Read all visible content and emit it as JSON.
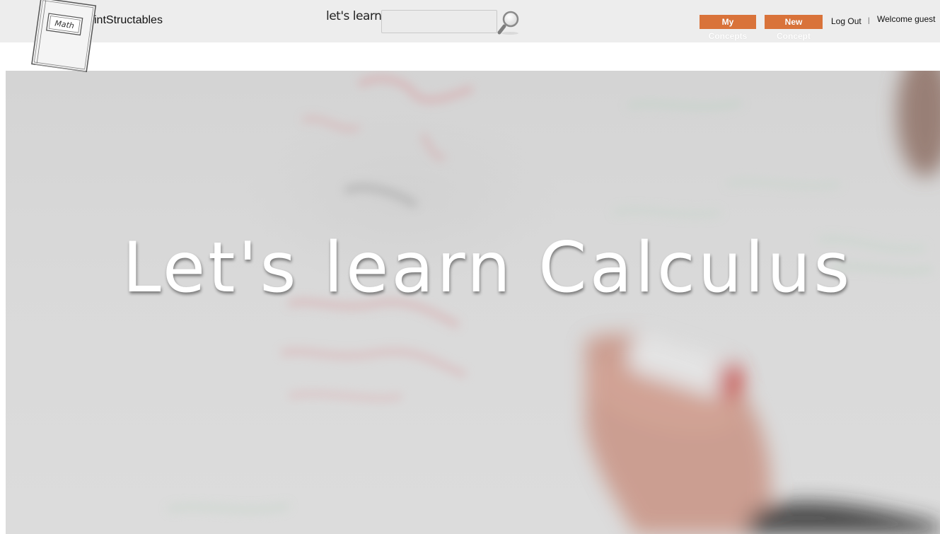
{
  "header": {
    "brand": "intStructables",
    "logo_text": "Math",
    "search_label": "let's learn",
    "search": {
      "value": "",
      "placeholder": ""
    },
    "buttons": {
      "my_concepts": "My Concepts",
      "new_concept": "New Concept"
    },
    "logout": "Log Out",
    "divider": "|",
    "welcome": "Welcome guest"
  },
  "hero": {
    "title": "Let's learn Calculus"
  },
  "colors": {
    "accent": "#d9733a",
    "topbar_bg": "#ededed"
  },
  "icons": [
    "notebook-logo-icon",
    "magnifier-icon"
  ]
}
